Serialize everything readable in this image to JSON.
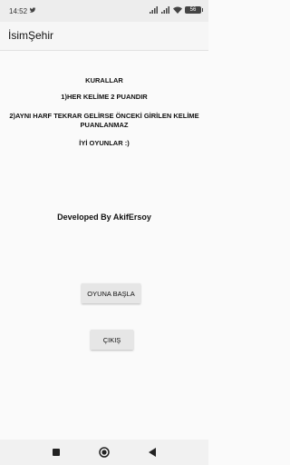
{
  "status": {
    "time": "14:52",
    "battery": "56"
  },
  "app_bar": {
    "title": "İsimŞehir"
  },
  "rules": {
    "heading": "KURALLAR",
    "rule1": "1)HER KELİME 2 PUANDIR",
    "rule2_line1": "2)AYNI HARF TEKRAR GELİRSE ÖNCEKİ GİRİLEN KELİME",
    "rule2_line2": "PUANLANMAZ",
    "closing": "İYİ OYUNLAR :)"
  },
  "developer": "Developed By AkifErsoy",
  "buttons": {
    "start_label": "OYUNA BAŞLA",
    "exit_label": "ÇIKIŞ"
  },
  "icons": {
    "status_app": "twitter-bird-icon",
    "signal": "signal-icon",
    "wifi": "wifi-icon",
    "battery": "battery-icon",
    "nav_recent": "square-icon",
    "nav_home": "circle-icon",
    "nav_back": "triangle-back-icon"
  },
  "colors": {
    "status_bar": "#ededed",
    "app_bar": "#f6f6f6",
    "background": "#fafafa",
    "button": "#e6e6e6"
  }
}
